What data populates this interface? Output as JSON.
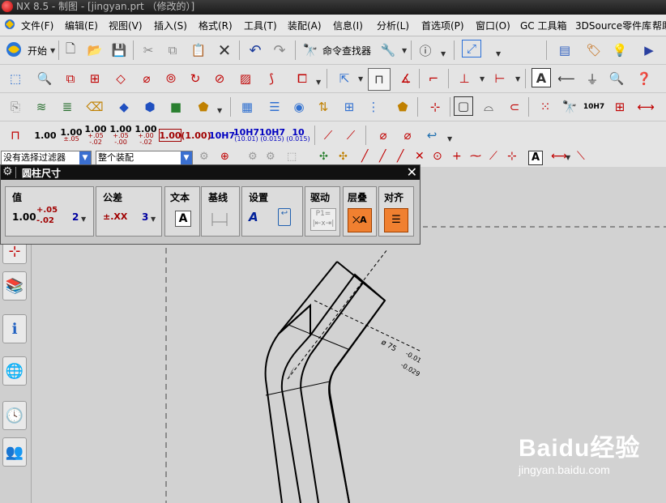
{
  "window": {
    "title": "NX 8.5 - 制图 - [jingyan.prt （修改的）]"
  },
  "menu": {
    "items": [
      "文件(F)",
      "编辑(E)",
      "视图(V)",
      "插入(S)",
      "格式(R)",
      "工具(T)",
      "装配(A)",
      "信息(I)",
      "分析(L)",
      "首选项(P)",
      "窗口(O)",
      "GC 工具箱",
      "3DSource零件库",
      "帮助"
    ]
  },
  "toolbar": {
    "start_label": "开始",
    "command_finder_label": "命令查找器"
  },
  "dim_toolbar": {
    "v1": "1.00",
    "v2": "1.00",
    "v2_tol": "±.05",
    "v3": "1.00",
    "v3_tol_a": "+.05",
    "v3_tol_b": "-.02",
    "v4": "1.00",
    "v4_tol_a": "+.05",
    "v4_tol_b": "-.00",
    "v5": "1.00",
    "v5_tol_a": "+.00",
    "v5_tol_b": "-.02",
    "v6": "1.00",
    "v7": "(1.00)",
    "fit1": "10H7",
    "fit2": "10H7",
    "fit2_sub": "(10.01)",
    "fit3": "10H7",
    "fit3_sub": "(0.015)",
    "fit4": "10",
    "fit4_sub": "(0.015)"
  },
  "selection_bar": {
    "filter": "没有选择过滤器",
    "scope": "整个装配"
  },
  "dialog": {
    "title": "圆柱尺寸",
    "groups": {
      "value": {
        "label": "值",
        "nominal": "1.00",
        "upper": "+.05",
        "lower": "-.02",
        "precision": "2"
      },
      "tolerance": {
        "label": "公差",
        "format": "±.XX",
        "precision": "3"
      },
      "text": {
        "label": "文本"
      },
      "baseline": {
        "label": "基线"
      },
      "settings": {
        "label": "设置"
      },
      "driving": {
        "label": "驱动",
        "placeholder": "P1="
      },
      "layer": {
        "label": "层叠"
      },
      "align": {
        "label": "对齐"
      }
    }
  },
  "drawing": {
    "dimension_text": "ø 75",
    "upper_tol": "-0.01",
    "lower_tol": "-0.029"
  },
  "watermark": {
    "brand": "Baidu经验",
    "url": "jingyan.baidu.com"
  },
  "colors": {
    "accent_orange": "#f08030",
    "dimension_red": "#a00000"
  }
}
